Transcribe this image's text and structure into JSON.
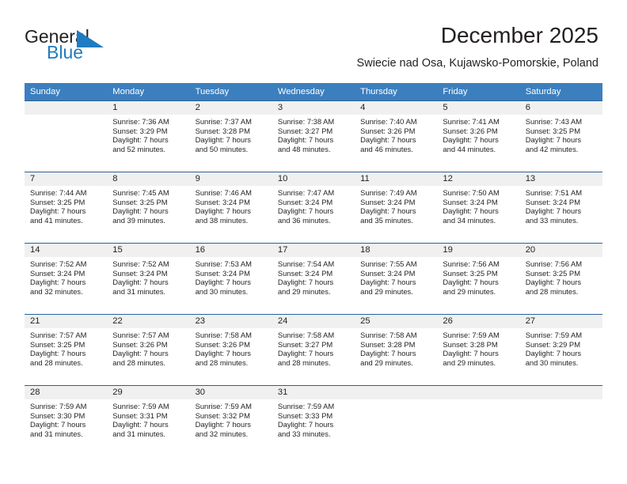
{
  "brand": {
    "name_part1": "General",
    "name_part2": "Blue",
    "flag_icon": "triangle-flag-icon",
    "accent_color": "#1f7cc1"
  },
  "header": {
    "title": "December 2025",
    "subtitle": "Swiecie nad Osa, Kujawsko-Pomorskie, Poland"
  },
  "calendar": {
    "header_bg": "#3c7fbe",
    "daynum_bg": "#f0f0f0",
    "grid_line_color": "#2a6099",
    "weekday_headers": [
      "Sunday",
      "Monday",
      "Tuesday",
      "Wednesday",
      "Thursday",
      "Friday",
      "Saturday"
    ],
    "weeks": [
      [
        {
          "day": "",
          "sunrise": "",
          "sunset": "",
          "daylight_line1": "",
          "daylight_line2": ""
        },
        {
          "day": "1",
          "sunrise": "Sunrise: 7:36 AM",
          "sunset": "Sunset: 3:29 PM",
          "daylight_line1": "Daylight: 7 hours",
          "daylight_line2": "and 52 minutes."
        },
        {
          "day": "2",
          "sunrise": "Sunrise: 7:37 AM",
          "sunset": "Sunset: 3:28 PM",
          "daylight_line1": "Daylight: 7 hours",
          "daylight_line2": "and 50 minutes."
        },
        {
          "day": "3",
          "sunrise": "Sunrise: 7:38 AM",
          "sunset": "Sunset: 3:27 PM",
          "daylight_line1": "Daylight: 7 hours",
          "daylight_line2": "and 48 minutes."
        },
        {
          "day": "4",
          "sunrise": "Sunrise: 7:40 AM",
          "sunset": "Sunset: 3:26 PM",
          "daylight_line1": "Daylight: 7 hours",
          "daylight_line2": "and 46 minutes."
        },
        {
          "day": "5",
          "sunrise": "Sunrise: 7:41 AM",
          "sunset": "Sunset: 3:26 PM",
          "daylight_line1": "Daylight: 7 hours",
          "daylight_line2": "and 44 minutes."
        },
        {
          "day": "6",
          "sunrise": "Sunrise: 7:43 AM",
          "sunset": "Sunset: 3:25 PM",
          "daylight_line1": "Daylight: 7 hours",
          "daylight_line2": "and 42 minutes."
        }
      ],
      [
        {
          "day": "7",
          "sunrise": "Sunrise: 7:44 AM",
          "sunset": "Sunset: 3:25 PM",
          "daylight_line1": "Daylight: 7 hours",
          "daylight_line2": "and 41 minutes."
        },
        {
          "day": "8",
          "sunrise": "Sunrise: 7:45 AM",
          "sunset": "Sunset: 3:25 PM",
          "daylight_line1": "Daylight: 7 hours",
          "daylight_line2": "and 39 minutes."
        },
        {
          "day": "9",
          "sunrise": "Sunrise: 7:46 AM",
          "sunset": "Sunset: 3:24 PM",
          "daylight_line1": "Daylight: 7 hours",
          "daylight_line2": "and 38 minutes."
        },
        {
          "day": "10",
          "sunrise": "Sunrise: 7:47 AM",
          "sunset": "Sunset: 3:24 PM",
          "daylight_line1": "Daylight: 7 hours",
          "daylight_line2": "and 36 minutes."
        },
        {
          "day": "11",
          "sunrise": "Sunrise: 7:49 AM",
          "sunset": "Sunset: 3:24 PM",
          "daylight_line1": "Daylight: 7 hours",
          "daylight_line2": "and 35 minutes."
        },
        {
          "day": "12",
          "sunrise": "Sunrise: 7:50 AM",
          "sunset": "Sunset: 3:24 PM",
          "daylight_line1": "Daylight: 7 hours",
          "daylight_line2": "and 34 minutes."
        },
        {
          "day": "13",
          "sunrise": "Sunrise: 7:51 AM",
          "sunset": "Sunset: 3:24 PM",
          "daylight_line1": "Daylight: 7 hours",
          "daylight_line2": "and 33 minutes."
        }
      ],
      [
        {
          "day": "14",
          "sunrise": "Sunrise: 7:52 AM",
          "sunset": "Sunset: 3:24 PM",
          "daylight_line1": "Daylight: 7 hours",
          "daylight_line2": "and 32 minutes."
        },
        {
          "day": "15",
          "sunrise": "Sunrise: 7:52 AM",
          "sunset": "Sunset: 3:24 PM",
          "daylight_line1": "Daylight: 7 hours",
          "daylight_line2": "and 31 minutes."
        },
        {
          "day": "16",
          "sunrise": "Sunrise: 7:53 AM",
          "sunset": "Sunset: 3:24 PM",
          "daylight_line1": "Daylight: 7 hours",
          "daylight_line2": "and 30 minutes."
        },
        {
          "day": "17",
          "sunrise": "Sunrise: 7:54 AM",
          "sunset": "Sunset: 3:24 PM",
          "daylight_line1": "Daylight: 7 hours",
          "daylight_line2": "and 29 minutes."
        },
        {
          "day": "18",
          "sunrise": "Sunrise: 7:55 AM",
          "sunset": "Sunset: 3:24 PM",
          "daylight_line1": "Daylight: 7 hours",
          "daylight_line2": "and 29 minutes."
        },
        {
          "day": "19",
          "sunrise": "Sunrise: 7:56 AM",
          "sunset": "Sunset: 3:25 PM",
          "daylight_line1": "Daylight: 7 hours",
          "daylight_line2": "and 29 minutes."
        },
        {
          "day": "20",
          "sunrise": "Sunrise: 7:56 AM",
          "sunset": "Sunset: 3:25 PM",
          "daylight_line1": "Daylight: 7 hours",
          "daylight_line2": "and 28 minutes."
        }
      ],
      [
        {
          "day": "21",
          "sunrise": "Sunrise: 7:57 AM",
          "sunset": "Sunset: 3:25 PM",
          "daylight_line1": "Daylight: 7 hours",
          "daylight_line2": "and 28 minutes."
        },
        {
          "day": "22",
          "sunrise": "Sunrise: 7:57 AM",
          "sunset": "Sunset: 3:26 PM",
          "daylight_line1": "Daylight: 7 hours",
          "daylight_line2": "and 28 minutes."
        },
        {
          "day": "23",
          "sunrise": "Sunrise: 7:58 AM",
          "sunset": "Sunset: 3:26 PM",
          "daylight_line1": "Daylight: 7 hours",
          "daylight_line2": "and 28 minutes."
        },
        {
          "day": "24",
          "sunrise": "Sunrise: 7:58 AM",
          "sunset": "Sunset: 3:27 PM",
          "daylight_line1": "Daylight: 7 hours",
          "daylight_line2": "and 28 minutes."
        },
        {
          "day": "25",
          "sunrise": "Sunrise: 7:58 AM",
          "sunset": "Sunset: 3:28 PM",
          "daylight_line1": "Daylight: 7 hours",
          "daylight_line2": "and 29 minutes."
        },
        {
          "day": "26",
          "sunrise": "Sunrise: 7:59 AM",
          "sunset": "Sunset: 3:28 PM",
          "daylight_line1": "Daylight: 7 hours",
          "daylight_line2": "and 29 minutes."
        },
        {
          "day": "27",
          "sunrise": "Sunrise: 7:59 AM",
          "sunset": "Sunset: 3:29 PM",
          "daylight_line1": "Daylight: 7 hours",
          "daylight_line2": "and 30 minutes."
        }
      ],
      [
        {
          "day": "28",
          "sunrise": "Sunrise: 7:59 AM",
          "sunset": "Sunset: 3:30 PM",
          "daylight_line1": "Daylight: 7 hours",
          "daylight_line2": "and 31 minutes."
        },
        {
          "day": "29",
          "sunrise": "Sunrise: 7:59 AM",
          "sunset": "Sunset: 3:31 PM",
          "daylight_line1": "Daylight: 7 hours",
          "daylight_line2": "and 31 minutes."
        },
        {
          "day": "30",
          "sunrise": "Sunrise: 7:59 AM",
          "sunset": "Sunset: 3:32 PM",
          "daylight_line1": "Daylight: 7 hours",
          "daylight_line2": "and 32 minutes."
        },
        {
          "day": "31",
          "sunrise": "Sunrise: 7:59 AM",
          "sunset": "Sunset: 3:33 PM",
          "daylight_line1": "Daylight: 7 hours",
          "daylight_line2": "and 33 minutes."
        },
        {
          "day": "",
          "sunrise": "",
          "sunset": "",
          "daylight_line1": "",
          "daylight_line2": ""
        },
        {
          "day": "",
          "sunrise": "",
          "sunset": "",
          "daylight_line1": "",
          "daylight_line2": ""
        },
        {
          "day": "",
          "sunrise": "",
          "sunset": "",
          "daylight_line1": "",
          "daylight_line2": ""
        }
      ]
    ]
  }
}
